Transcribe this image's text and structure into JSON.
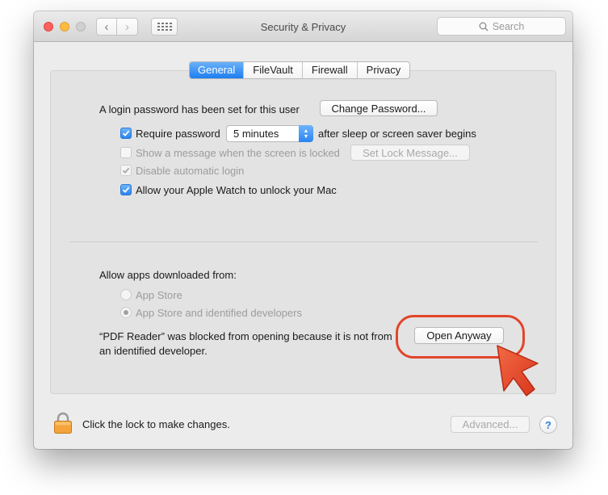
{
  "window": {
    "title": "Security & Privacy",
    "search_placeholder": "Search"
  },
  "tabs": [
    {
      "label": "General",
      "active": true
    },
    {
      "label": "FileVault",
      "active": false
    },
    {
      "label": "Firewall",
      "active": false
    },
    {
      "label": "Privacy",
      "active": false
    }
  ],
  "general": {
    "login_text": "A login password has been set for this user",
    "change_password_label": "Change Password...",
    "require_password_label": "Require password",
    "require_password_checked": true,
    "require_password_interval": "5 minutes",
    "after_sleep_text": "after sleep or screen saver begins",
    "show_message_label": "Show a message when the screen is locked",
    "show_message_checked": false,
    "set_lock_message_label": "Set Lock Message...",
    "disable_auto_login_label": "Disable automatic login",
    "disable_auto_login_checked": true,
    "apple_watch_label": "Allow your Apple Watch to unlock your Mac",
    "apple_watch_checked": true
  },
  "downloads": {
    "heading": "Allow apps downloaded from:",
    "options": [
      {
        "label": "App Store",
        "selected": false
      },
      {
        "label": "App Store and identified developers",
        "selected": true
      }
    ],
    "blocked_line1": "“PDF Reader” was blocked from opening because it is not from",
    "blocked_line2": "an identified developer.",
    "open_anyway_label": "Open Anyway"
  },
  "footer": {
    "lock_text": "Click the lock to make changes.",
    "advanced_label": "Advanced...",
    "help_label": "?"
  },
  "colors": {
    "accent": "#1e7ef0",
    "callout": "#e2452b"
  }
}
